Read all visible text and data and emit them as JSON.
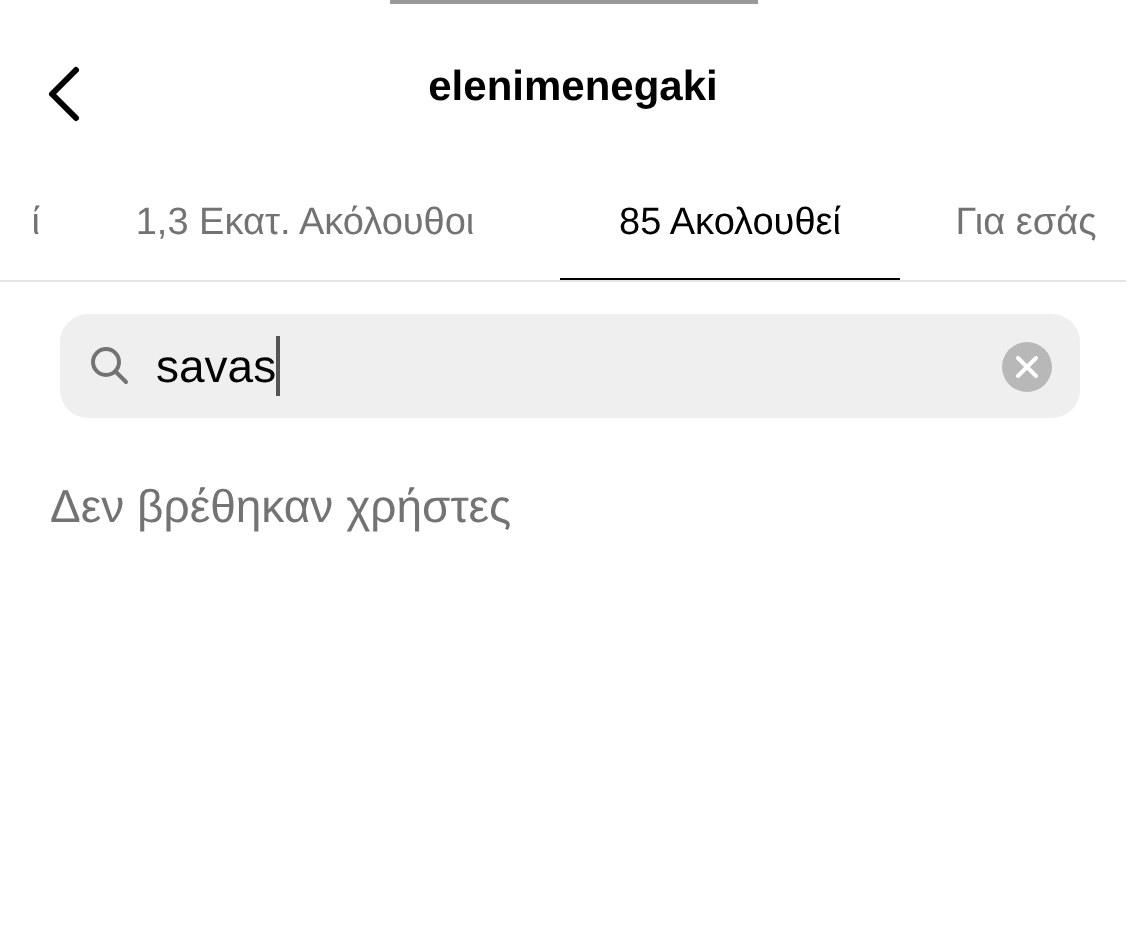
{
  "header": {
    "title": "elenimenegaki"
  },
  "tabs": [
    {
      "label": "ί",
      "selected": false
    },
    {
      "label": "1,3 Εκατ. Ακόλουθοι",
      "selected": false
    },
    {
      "label": "85 Ακολουθεί",
      "selected": true
    },
    {
      "label": "Για εσάς",
      "selected": false
    }
  ],
  "search": {
    "value": "savas"
  },
  "empty_message": "Δεν βρέθηκαν χρήστες"
}
